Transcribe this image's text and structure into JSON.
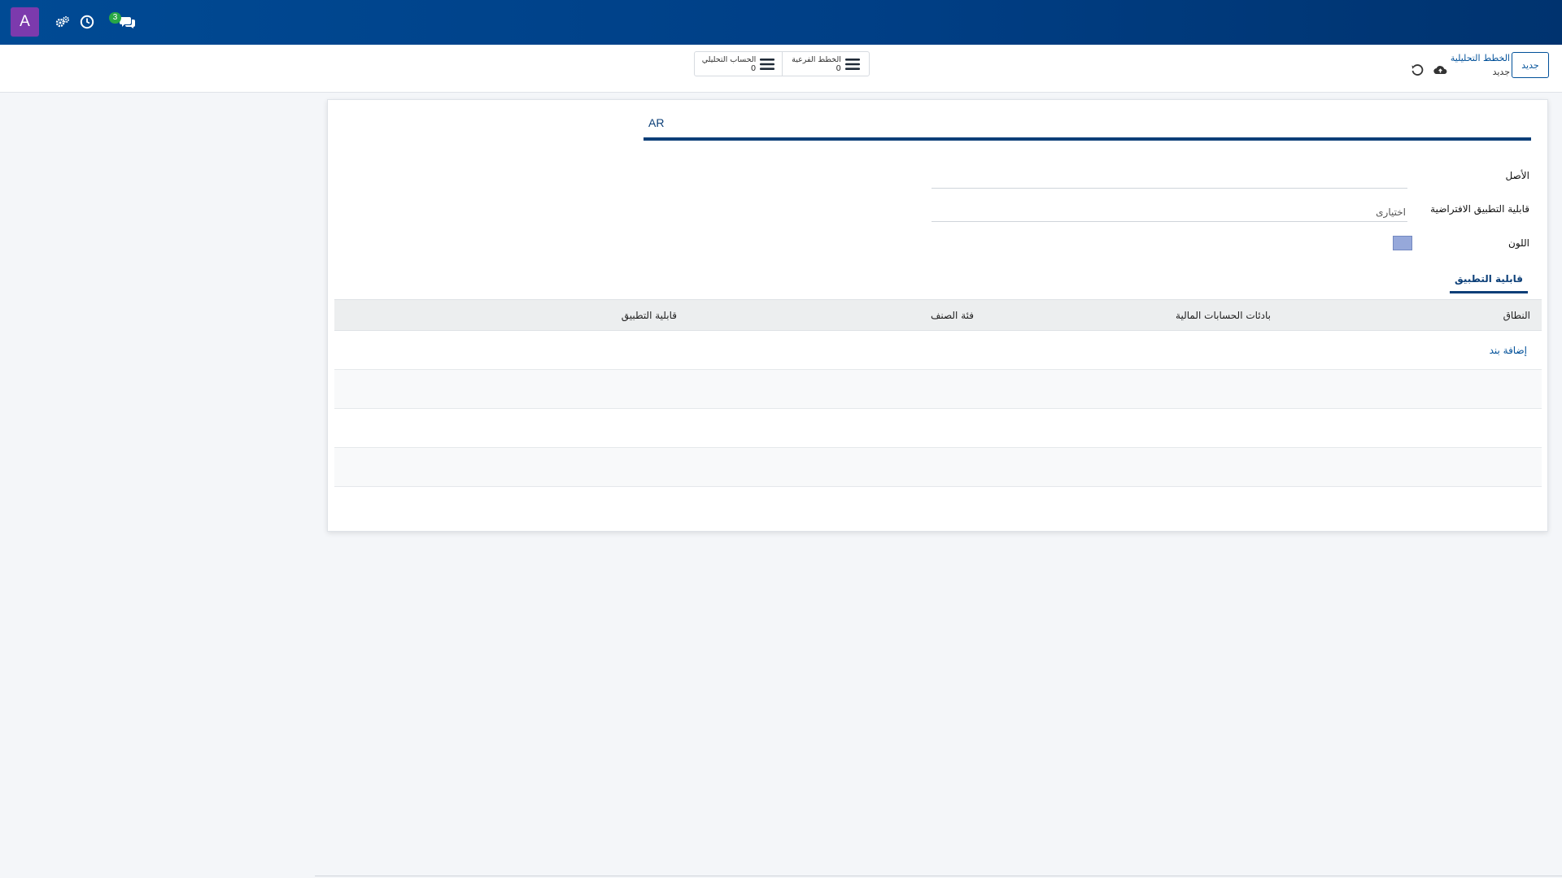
{
  "navbar": {
    "avatar_letter": "A",
    "icons": [
      "settings-gears-icon",
      "clock-icon",
      "chat-icon"
    ],
    "messages_count": "3",
    "colors": {
      "bar": "#004a94",
      "avatar": "#7c3aad",
      "badge": "#28a745"
    }
  },
  "control_panel": {
    "breadcrumb_root": "الخطط التحليلية",
    "breadcrumb_current": "جديد",
    "new_button": "جديد",
    "smart_buttons": [
      {
        "label": "الخطط الفرعية",
        "value": "0",
        "icon": "menu-icon"
      },
      {
        "label": "الحساب التحليلي",
        "value": "0",
        "icon": "menu-icon"
      }
    ]
  },
  "form": {
    "lang_tab": "AR",
    "fields": {
      "parent_label": "الأصل",
      "parent_value": "",
      "applicability_label": "قابلية التطبيق الافتراضية",
      "applicability_value": "اختيارى",
      "color_label": "اللون",
      "color_value": "#96a8da"
    },
    "notebook_tab": "قابلية التطبيق",
    "table": {
      "columns": [
        "النطاق",
        "بادئات الحسابات المالية",
        "فئة الصنف",
        "قابلية التطبيق"
      ],
      "add_line": "إضافة بند"
    }
  }
}
